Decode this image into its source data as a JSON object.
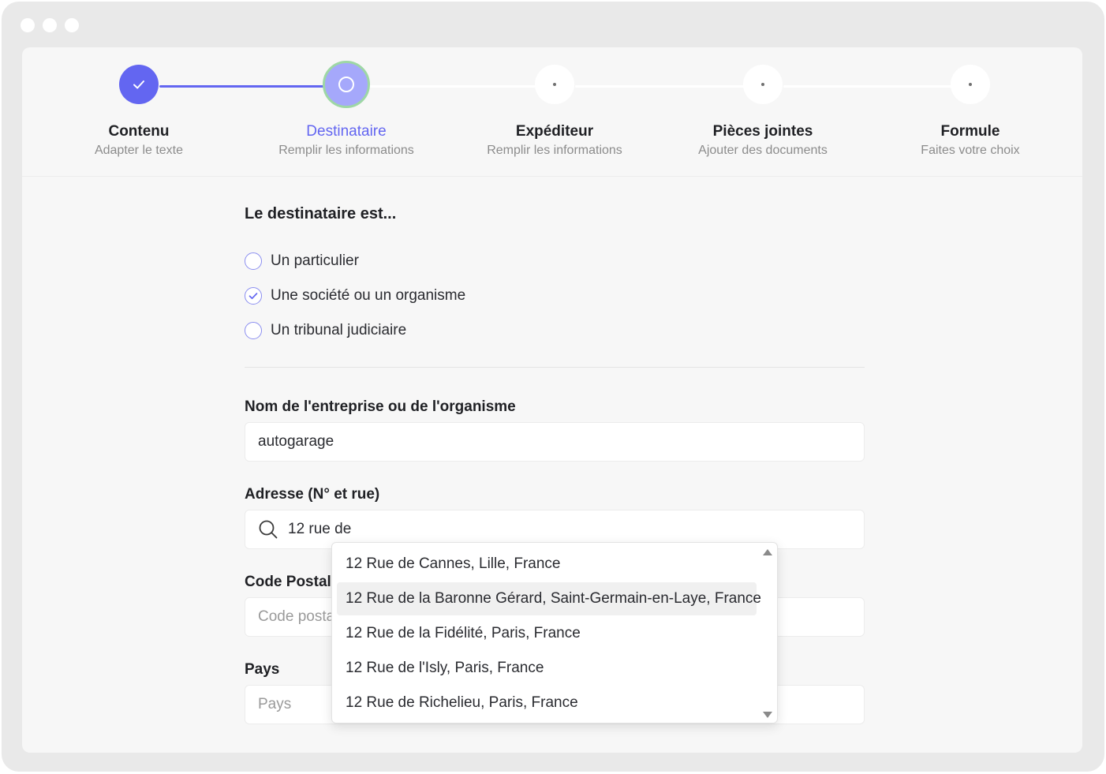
{
  "stepper": {
    "steps": [
      {
        "title": "Contenu",
        "subtitle": "Adapter le texte",
        "state": "complete"
      },
      {
        "title": "Destinataire",
        "subtitle": "Remplir les informations",
        "state": "current"
      },
      {
        "title": "Expéditeur",
        "subtitle": "Remplir les informations",
        "state": "pending"
      },
      {
        "title": "Pièces jointes",
        "subtitle": "Ajouter des documents",
        "state": "pending"
      },
      {
        "title": "Formule",
        "subtitle": "Faites votre choix",
        "state": "pending"
      }
    ]
  },
  "recipient": {
    "title": "Le destinataire est...",
    "options": [
      {
        "label": "Un particulier",
        "checked": false
      },
      {
        "label": "Une société ou un organisme",
        "checked": true
      },
      {
        "label": "Un tribunal judiciaire",
        "checked": false
      }
    ]
  },
  "fields": {
    "company": {
      "label": "Nom de l'entreprise ou de l'organisme",
      "value": "autogarage"
    },
    "address": {
      "label": "Adresse (N° et rue)",
      "value": "12 rue de"
    },
    "postal": {
      "label": "Code Postal",
      "placeholder": "Code postal"
    },
    "country": {
      "label": "Pays",
      "placeholder": "Pays"
    }
  },
  "suggestions": {
    "highlighted_index": 1,
    "items": [
      "12 Rue de Cannes, Lille, France",
      "12 Rue de la Baronne Gérard, Saint-Germain-en-Laye, France",
      "12 Rue de la Fidélité, Paris, France",
      "12 Rue de l'Isly, Paris, France",
      "12 Rue de Richelieu, Paris, France"
    ]
  },
  "colors": {
    "accent": "#6366f1",
    "accent_light": "#a5a8fb",
    "focus_ring": "#9ed7a5",
    "muted_text": "#8c8c8c"
  },
  "icons": {
    "complete_step": "check-icon",
    "current_step": "ring-icon",
    "address_input": "search-icon",
    "dropdown_scroll_up": "triangle-up-icon",
    "dropdown_scroll_down": "triangle-down-icon"
  }
}
